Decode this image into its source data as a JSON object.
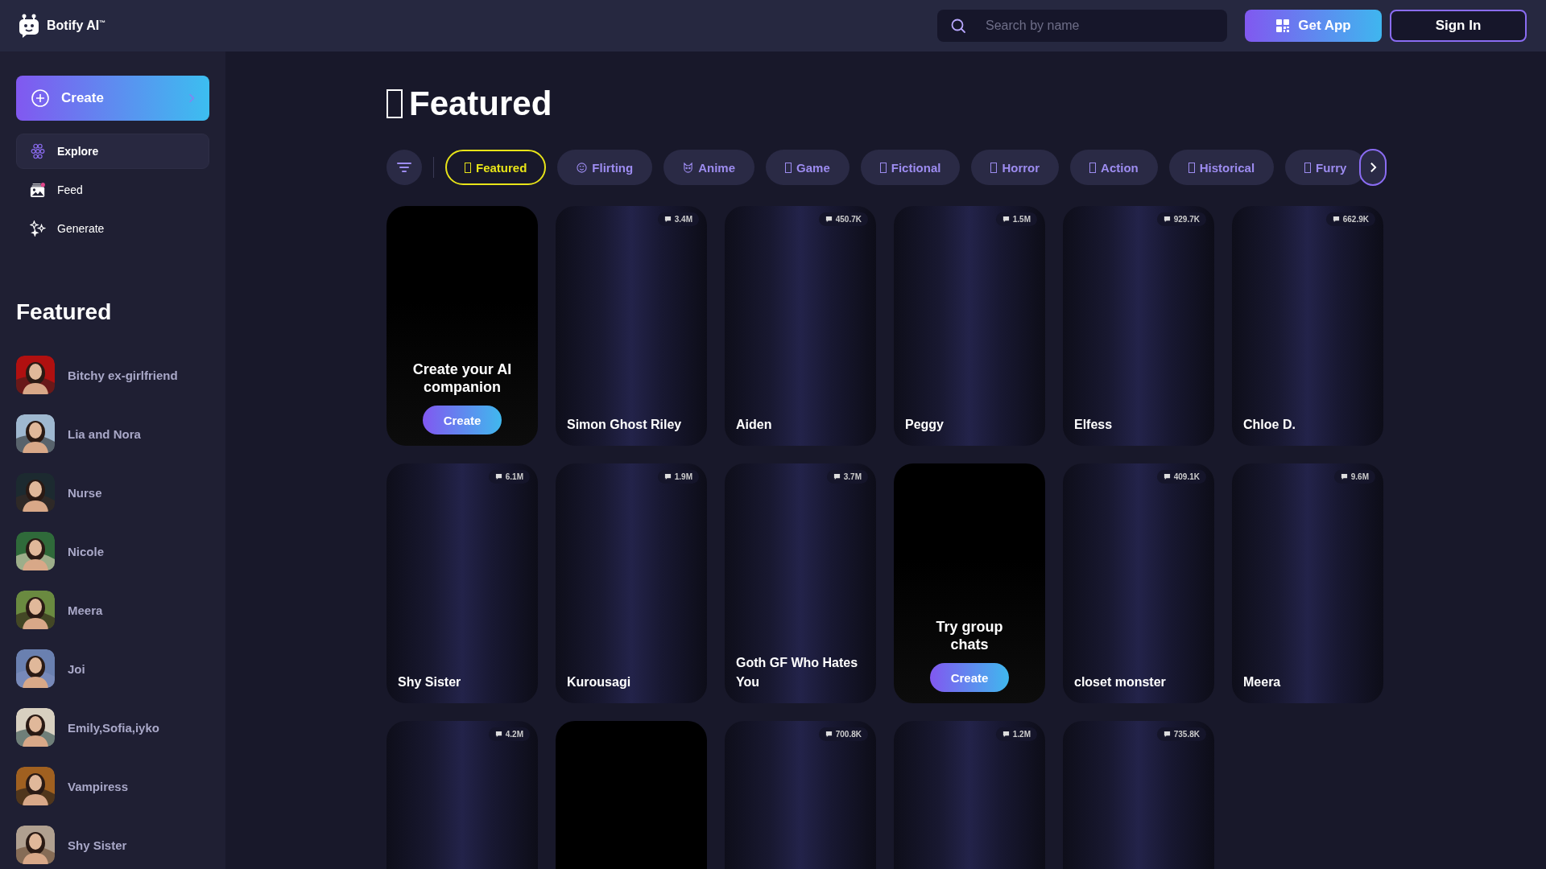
{
  "brand": {
    "name": "Botify AI$^{™}$"
  },
  "search": {
    "placeholder": "Search by name"
  },
  "header_buttons": {
    "get_app": "Get App",
    "sign_in": "Sign In"
  },
  "sidebar": {
    "create": "Create",
    "nav": [
      {
        "label": "Explore",
        "kind": "explore",
        "selected": true
      },
      {
        "label": "Feed",
        "kind": "feed",
        "selected": false
      },
      {
        "label": "Generate",
        "kind": "generate",
        "selected": false
      }
    ],
    "featured_title": "Featured",
    "featured": [
      {
        "name": "Bitchy ex-girlfriend"
      },
      {
        "name": "Lia and Nora"
      },
      {
        "name": "Nurse"
      },
      {
        "name": "Nicole"
      },
      {
        "name": "Meera"
      },
      {
        "name": "Joi"
      },
      {
        "name": "Emily,Sofia,iyko"
      },
      {
        "name": "Vampiress"
      },
      {
        "name": "Shy Sister"
      }
    ]
  },
  "page_title": "Featured",
  "tabs": [
    {
      "label": "Featured",
      "kind": "box",
      "selected": true
    },
    {
      "label": "Flirting",
      "kind": "smile",
      "selected": false
    },
    {
      "label": "Anime",
      "kind": "cat",
      "selected": false
    },
    {
      "label": "Game",
      "kind": "box",
      "selected": false
    },
    {
      "label": "Fictional",
      "kind": "box",
      "selected": false
    },
    {
      "label": "Horror",
      "kind": "box",
      "selected": false
    },
    {
      "label": "Action",
      "kind": "box",
      "selected": false
    },
    {
      "label": "Historical",
      "kind": "box",
      "selected": false
    },
    {
      "label": "Furry",
      "kind": "box",
      "selected": false
    }
  ],
  "cards": [
    {
      "kind": "promo",
      "title": "Create your AI companion",
      "button": "Create"
    },
    {
      "kind": "character",
      "name": "Simon Ghost Riley",
      "count": "3.4M"
    },
    {
      "kind": "character",
      "name": "Aiden",
      "count": "450.7K"
    },
    {
      "kind": "character",
      "name": "Peggy",
      "count": "1.5M"
    },
    {
      "kind": "character",
      "name": "Elfess",
      "count": "929.7K"
    },
    {
      "kind": "character",
      "name": "Chloe D.",
      "count": "662.9K"
    },
    {
      "kind": "character",
      "name": "Shy Sister",
      "count": "6.1M"
    },
    {
      "kind": "character",
      "name": "Kurousagi",
      "count": "1.9M"
    },
    {
      "kind": "character",
      "name": "Goth GF Who Hates You",
      "count": "3.7M"
    },
    {
      "kind": "promo",
      "title": "Try group chats",
      "button": "Create"
    },
    {
      "kind": "character",
      "name": "closet monster",
      "count": "409.1K"
    },
    {
      "kind": "character",
      "name": "Meera",
      "count": "9.6M"
    },
    {
      "kind": "character",
      "count": "4.2M"
    },
    {
      "kind": "blank"
    },
    {
      "kind": "character",
      "count": "700.8K"
    },
    {
      "kind": "character",
      "count": "1.2M"
    },
    {
      "kind": "character",
      "count": "735.8K"
    }
  ]
}
